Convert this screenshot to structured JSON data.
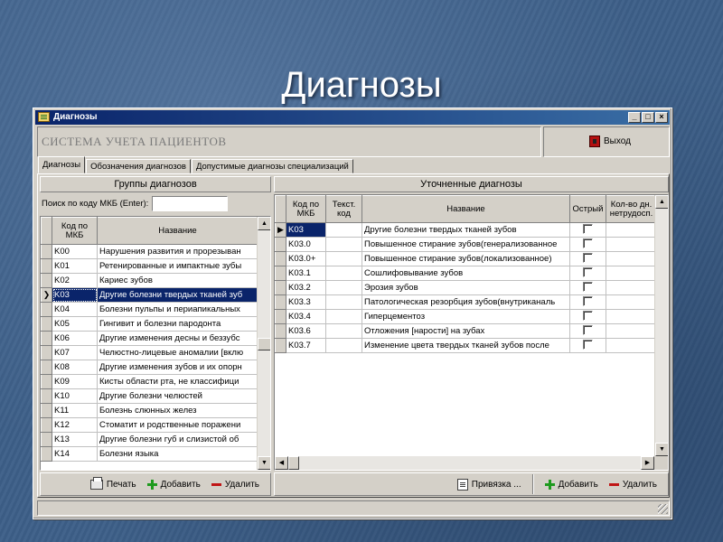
{
  "slide_title": "Диагнозы",
  "window": {
    "title": "Диагнозы",
    "minimize": "_",
    "maximize": "□",
    "close": "×"
  },
  "header": {
    "system_title": "СИСТЕМА УЧЕТА ПАЦИЕНТОВ",
    "exit_label": "Выход"
  },
  "tabs": [
    {
      "label": "Диагнозы",
      "active": true
    },
    {
      "label": "Обозначения диагнозов",
      "active": false
    },
    {
      "label": "Допустимые диагнозы специализаций",
      "active": false
    }
  ],
  "left_panel": {
    "caption": "Группы диагнозов",
    "search_label": "Поиск по коду МКБ (Enter):",
    "search_value": "",
    "columns": [
      "Код по МКБ",
      "Название"
    ],
    "rows": [
      {
        "code": "K00",
        "name": "Нарушения развития и прорезыван"
      },
      {
        "code": "K01",
        "name": "Ретенированные и импактные зубы"
      },
      {
        "code": "K02",
        "name": "Кариес зубов"
      },
      {
        "code": "K03",
        "name": "Другие болезни твердых тканей зуб",
        "selected": true
      },
      {
        "code": "K04",
        "name": "Болезни пульпы и периапикальных"
      },
      {
        "code": "K05",
        "name": "Гингивит и болезни пародонта"
      },
      {
        "code": "K06",
        "name": "Другие изменения десны и беззубс"
      },
      {
        "code": "K07",
        "name": "Челюстно-лицевые аномалии [вклю"
      },
      {
        "code": "K08",
        "name": "Другие изменения зубов и их опорн"
      },
      {
        "code": "K09",
        "name": "Кисты области рта, не классифици"
      },
      {
        "code": "K10",
        "name": "Другие болезни челюстей"
      },
      {
        "code": "K11",
        "name": "Болезнь слюнных желез"
      },
      {
        "code": "K12",
        "name": "Стоматит и родственные поражени"
      },
      {
        "code": "K13",
        "name": "Другие болезни губ и слизистой об"
      },
      {
        "code": "K14",
        "name": "Болезни языка"
      }
    ],
    "buttons": {
      "print": "Печать",
      "add": "Добавить",
      "delete": "Удалить"
    }
  },
  "right_panel": {
    "caption": "Уточненные диагнозы",
    "columns": [
      "Код по МКБ",
      "Текст. код",
      "Название",
      "Острый",
      "Кол-во дн. нетрудосп."
    ],
    "rows": [
      {
        "code": "K03",
        "text_code": "",
        "name": "Другие болезни твердых тканей зубов",
        "selected": true
      },
      {
        "code": "K03.0",
        "text_code": "",
        "name": "Повышенное стирание зубов(генерализованное"
      },
      {
        "code": "K03.0+",
        "text_code": "",
        "name": "Повышенное стирание зубов(локализованное)"
      },
      {
        "code": "K03.1",
        "text_code": "",
        "name": "Сошлифовывание зубов"
      },
      {
        "code": "K03.2",
        "text_code": "",
        "name": "Эрозия зубов"
      },
      {
        "code": "K03.3",
        "text_code": "",
        "name": "Патологическая резорбция зубов(внутриканаль"
      },
      {
        "code": "K03.4",
        "text_code": "",
        "name": "Гиперцементоз"
      },
      {
        "code": "K03.6",
        "text_code": "",
        "name": "Отложения [нарости] на зубах"
      },
      {
        "code": "K03.7",
        "text_code": "",
        "name": "Изменение цвета твердых тканей зубов после"
      }
    ],
    "buttons": {
      "link": "Привязка ...",
      "add": "Добавить",
      "delete": "Удалить"
    }
  },
  "colors": {
    "selection": "#0a246a",
    "titlebar": "#0a246a",
    "face": "#d4d0c8"
  }
}
